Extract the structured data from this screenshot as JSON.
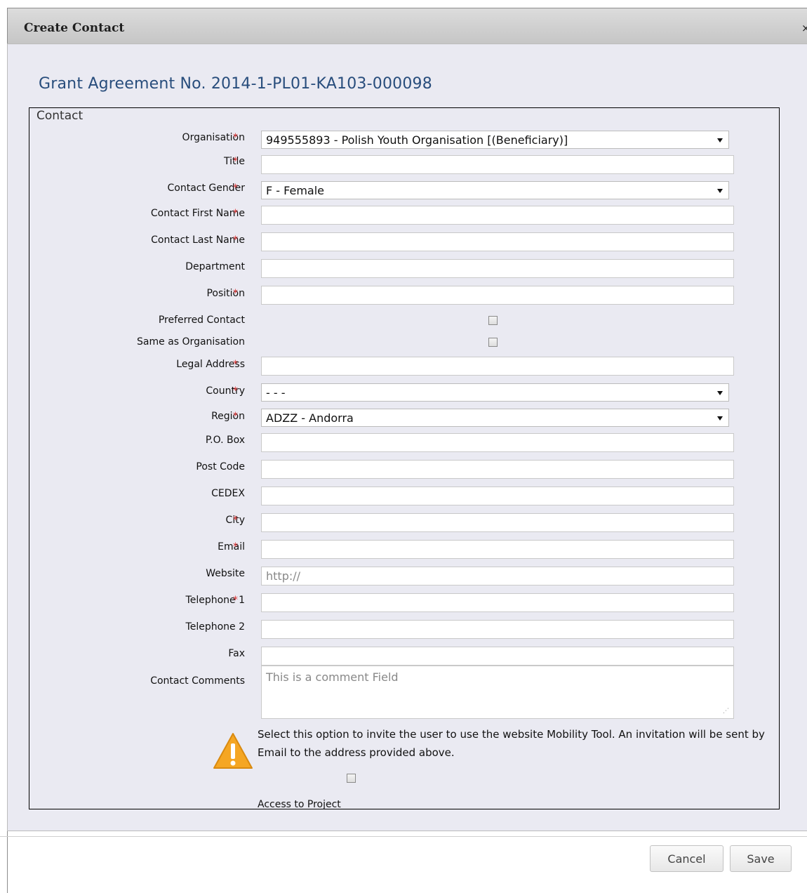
{
  "dialog": {
    "title": "Create Contact",
    "close_glyph": "×"
  },
  "grant_heading": "Grant Agreement No. 2014-1-PL01-KA103-000098",
  "section_legend": "Contact",
  "required_marker": "*",
  "fields": {
    "organisation": {
      "label": "Organisation",
      "required": true,
      "type": "select",
      "value": "949555893 - Polish Youth Organisation [(Beneficiary)]"
    },
    "title": {
      "label": "Title",
      "required": true,
      "type": "text",
      "value": ""
    },
    "contact_gender": {
      "label": "Contact Gender",
      "required": true,
      "type": "select",
      "value": "F - Female"
    },
    "first_name": {
      "label": "Contact First Name",
      "required": true,
      "type": "text",
      "value": ""
    },
    "last_name": {
      "label": "Contact Last Name",
      "required": true,
      "type": "text",
      "value": ""
    },
    "department": {
      "label": "Department",
      "required": false,
      "type": "text",
      "value": ""
    },
    "position": {
      "label": "Position",
      "required": true,
      "type": "text",
      "value": ""
    },
    "preferred_contact": {
      "label": "Preferred Contact",
      "required": false,
      "type": "checkbox",
      "checked": false
    },
    "same_as_organisation": {
      "label": "Same as Organisation",
      "required": false,
      "type": "checkbox",
      "checked": false
    },
    "legal_address": {
      "label": "Legal Address",
      "required": true,
      "type": "text",
      "value": ""
    },
    "country": {
      "label": "Country",
      "required": true,
      "type": "select",
      "value": "- - -"
    },
    "region": {
      "label": "Region",
      "required": true,
      "type": "select",
      "value": "ADZZ - Andorra"
    },
    "po_box": {
      "label": "P.O. Box",
      "required": false,
      "type": "text",
      "value": ""
    },
    "post_code": {
      "label": "Post Code",
      "required": false,
      "type": "text",
      "value": ""
    },
    "cedex": {
      "label": "CEDEX",
      "required": false,
      "type": "text",
      "value": ""
    },
    "city": {
      "label": "City",
      "required": true,
      "type": "text",
      "value": ""
    },
    "email": {
      "label": "Email",
      "required": true,
      "type": "text",
      "value": ""
    },
    "website": {
      "label": "Website",
      "required": false,
      "type": "text",
      "value": "",
      "placeholder": "http://"
    },
    "telephone_1": {
      "label": "Telephone 1",
      "required": true,
      "type": "text",
      "value": ""
    },
    "telephone_2": {
      "label": "Telephone 2",
      "required": false,
      "type": "text",
      "value": ""
    },
    "fax": {
      "label": "Fax",
      "required": false,
      "type": "text",
      "value": ""
    },
    "contact_comments": {
      "label": "Contact Comments",
      "required": false,
      "type": "textarea",
      "value": "",
      "placeholder": "This is a comment Field"
    }
  },
  "invite": {
    "icon": "warning-icon",
    "text": "Select this option to invite the user to use the website Mobility Tool. An invitation will be sent by Email to the address provided above.",
    "checked": false,
    "access_label": "Access to Project"
  },
  "buttons": {
    "cancel": "Cancel",
    "save": "Save"
  },
  "colors": {
    "heading": "#284d7c",
    "required": "#dd3333",
    "content_bg": "#eaeaf2",
    "warning": "#f5a623"
  }
}
